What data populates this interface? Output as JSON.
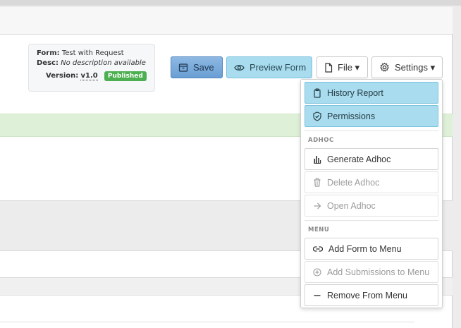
{
  "form_info": {
    "form_label": "Form:",
    "form_name": "Test with Request",
    "desc_label": "Desc:",
    "desc_value": "No description available",
    "version_label": "Version:",
    "version_value": "v1.0",
    "status_badge": "Published"
  },
  "toolbar": {
    "save_label": "Save",
    "preview_label": "Preview Form",
    "file_label": "File ▾",
    "settings_label": "Settings ▾"
  },
  "settings_menu": {
    "history_report": "History Report",
    "permissions": "Permissions",
    "adhoc_header": "ADHOC",
    "generate_adhoc": "Generate Adhoc",
    "delete_adhoc": "Delete Adhoc",
    "open_adhoc": "Open Adhoc",
    "menu_header": "MENU",
    "add_form_to_menu": "Add Form to Menu",
    "add_submissions_to_menu": "Add Submissions to Menu",
    "remove_from_menu": "Remove From Menu"
  },
  "colors": {
    "save_button": "#6a9fd4",
    "preview_button": "#a8dcee",
    "published_badge": "#4caf50",
    "success_bar": "#dff0d8"
  }
}
